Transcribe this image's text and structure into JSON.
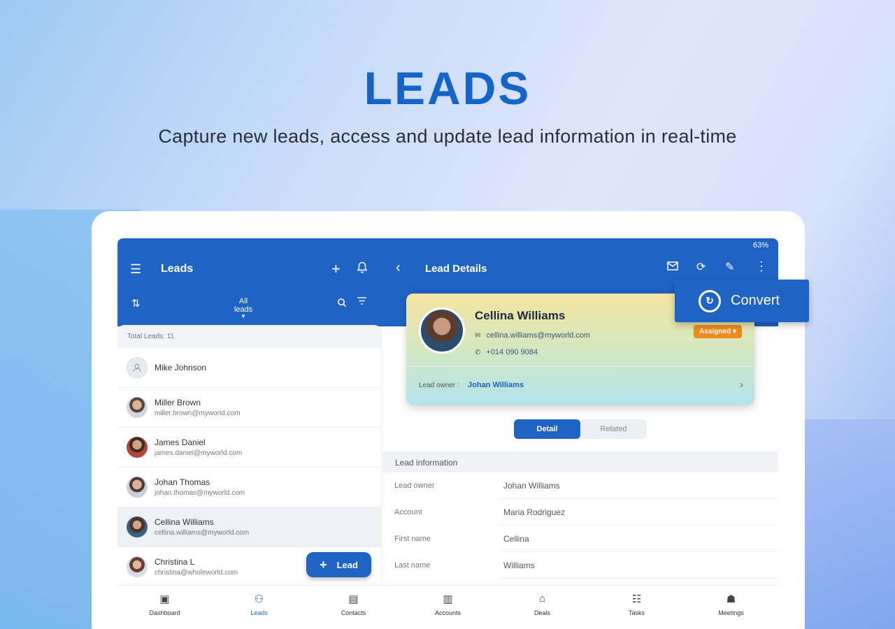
{
  "hero": {
    "title": "LEADS",
    "subtitle": "Capture new leads, access and update lead information in real-time"
  },
  "status": {
    "battery": "63%"
  },
  "left_pane": {
    "title": "Leads",
    "filter_label": "All leads",
    "total": "Total Leads: 11",
    "leads": [
      {
        "name": "Mike Johnson",
        "email": "",
        "avatar_color": "#e3e6ea"
      },
      {
        "name": "Miller Brown",
        "email": "miller.brown@myworld.com",
        "avatar_color": "#8a6a55"
      },
      {
        "name": "James Daniel",
        "email": "james.daniel@myworld.com",
        "avatar_color": "#b0493a"
      },
      {
        "name": "Johan Thomas",
        "email": "johan.thomas@myworld.com",
        "avatar_color": "#7d6b5f"
      },
      {
        "name": "Cellina Williams",
        "email": "cellina.williams@myworld.com",
        "avatar_color": "#3e5f85"
      },
      {
        "name": "Christina L",
        "email": "christina@wholeworld.com",
        "avatar_color": "#9b6f5e"
      }
    ],
    "fab_label": "Lead"
  },
  "right_pane": {
    "title": "Lead Details",
    "card": {
      "name": "Cellina Williams",
      "email": "cellina.williams@myworld.com",
      "phone": "+014 090 9084",
      "status": "Assigned",
      "owner_label": "Lead owner :",
      "owner": "Johan Williams"
    },
    "convert_label": "Convert",
    "tabs": [
      "Detail",
      "Related"
    ],
    "section_title": "Lead information",
    "fields": [
      {
        "key": "Lead owner",
        "value": "Johan Williams"
      },
      {
        "key": "Account",
        "value": "Maria Rodriguez"
      },
      {
        "key": "First name",
        "value": "Cellina"
      },
      {
        "key": "Last name",
        "value": "Williams"
      }
    ]
  },
  "bottom_nav": [
    {
      "label": "Dashboard",
      "icon": "dashboard-icon"
    },
    {
      "label": "Leads",
      "icon": "leads-icon"
    },
    {
      "label": "Contacts",
      "icon": "contacts-icon"
    },
    {
      "label": "Accounts",
      "icon": "accounts-icon"
    },
    {
      "label": "Deals",
      "icon": "deals-icon"
    },
    {
      "label": "Tasks",
      "icon": "tasks-icon"
    },
    {
      "label": "Meetings",
      "icon": "meetings-icon"
    }
  ],
  "colors": {
    "primary": "#1f63c4",
    "accent_orange": "#f18a1c",
    "title_blue": "#1565c8"
  }
}
